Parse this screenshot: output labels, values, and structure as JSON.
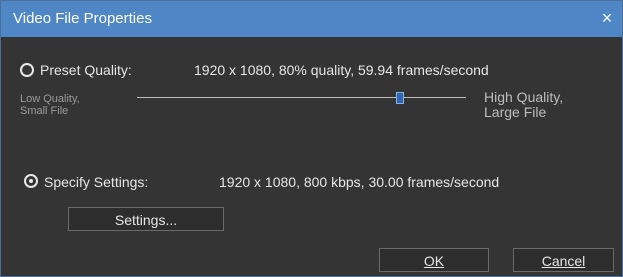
{
  "dialog": {
    "title": "Video File Properties",
    "close_glyph": "×",
    "preset": {
      "label": "Preset Quality:",
      "value": "1920 x 1080, 80% quality, 59.94 frames/second",
      "low_label_1": "Low Quality,",
      "low_label_2": "Small File",
      "high_label_1": "High Quality,",
      "high_label_2": "Large File",
      "slider_position_fraction": 0.8
    },
    "specify": {
      "label": "Specify Settings:",
      "value": "1920 x 1080, 800 kbps, 30.00 frames/second"
    },
    "buttons": {
      "settings": "Settings...",
      "ok": "OK",
      "cancel": "Cancel"
    }
  },
  "colors": {
    "titlebar": "#4f86c6",
    "background": "#343434",
    "text": "#e6e6e6",
    "slider_thumb": "#2f66ad"
  },
  "icons": {
    "close": "close-icon",
    "preset_radio": "radio-unchecked-icon",
    "specify_radio": "radio-checked-icon"
  }
}
